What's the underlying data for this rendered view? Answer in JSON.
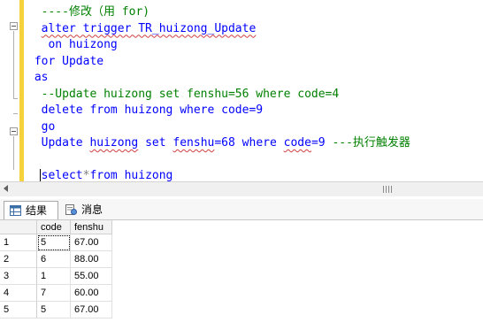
{
  "editor": {
    "lines": [
      [
        {
          "t": "  ",
          "c": ""
        },
        {
          "t": "----修改（用 for)",
          "c": "cm"
        }
      ],
      [
        {
          "t": "  ",
          "c": ""
        },
        {
          "t": "alter trigger TR_huizong_Update",
          "c": "kw ul"
        }
      ],
      [
        {
          "t": "   ",
          "c": ""
        },
        {
          "t": "on huizong",
          "c": "kw"
        }
      ],
      [
        {
          "t": " ",
          "c": ""
        },
        {
          "t": "for Update",
          "c": "kw"
        }
      ],
      [
        {
          "t": " ",
          "c": ""
        },
        {
          "t": "as",
          "c": "kw"
        }
      ],
      [
        {
          "t": "  ",
          "c": ""
        },
        {
          "t": "--Update huizong set fenshu=56 where code=4",
          "c": "cm"
        }
      ],
      [
        {
          "t": "  ",
          "c": ""
        },
        {
          "t": "delete from huizong where code=9",
          "c": "kw"
        }
      ],
      [
        {
          "t": "  ",
          "c": ""
        },
        {
          "t": "go",
          "c": "kw"
        }
      ],
      [
        {
          "t": "  ",
          "c": ""
        },
        {
          "t": "Update ",
          "c": "kw"
        },
        {
          "t": "huizong",
          "c": "kw ul"
        },
        {
          "t": " set ",
          "c": "kw"
        },
        {
          "t": "fenshu",
          "c": "kw ul"
        },
        {
          "t": "=68 where ",
          "c": "kw"
        },
        {
          "t": "code",
          "c": "kw ul"
        },
        {
          "t": "=9 ",
          "c": "kw"
        },
        {
          "t": "---执行触发器",
          "c": "cm"
        }
      ],
      [
        {
          "t": "",
          "c": ""
        }
      ],
      [
        {
          "t": "  ",
          "c": ""
        },
        {
          "t": "select",
          "c": "kw"
        },
        {
          "t": "*",
          "c": "gr"
        },
        {
          "t": "from ",
          "c": "kw"
        },
        {
          "t": "huizong",
          "c": "kw ul"
        }
      ]
    ]
  },
  "scrollbar": {
    "left_arrow_icon": "arrow-left-icon",
    "grip_label": "III"
  },
  "tabs": [
    {
      "label": "结果",
      "icon": "grid-icon",
      "active": true
    },
    {
      "label": "消息",
      "icon": "message-icon",
      "active": false
    }
  ],
  "results": {
    "columns": [
      "code",
      "fenshu"
    ],
    "rows": [
      {
        "num": "1",
        "code": "5",
        "fenshu": "67.00"
      },
      {
        "num": "2",
        "code": "6",
        "fenshu": "88.00"
      },
      {
        "num": "3",
        "code": "1",
        "fenshu": "55.00"
      },
      {
        "num": "4",
        "code": "7",
        "fenshu": "60.00"
      },
      {
        "num": "5",
        "code": "5",
        "fenshu": "67.00"
      }
    ]
  },
  "colors": {
    "keyword": "#0000ff",
    "comment": "#008000",
    "change_bar": "#f5d23b"
  }
}
